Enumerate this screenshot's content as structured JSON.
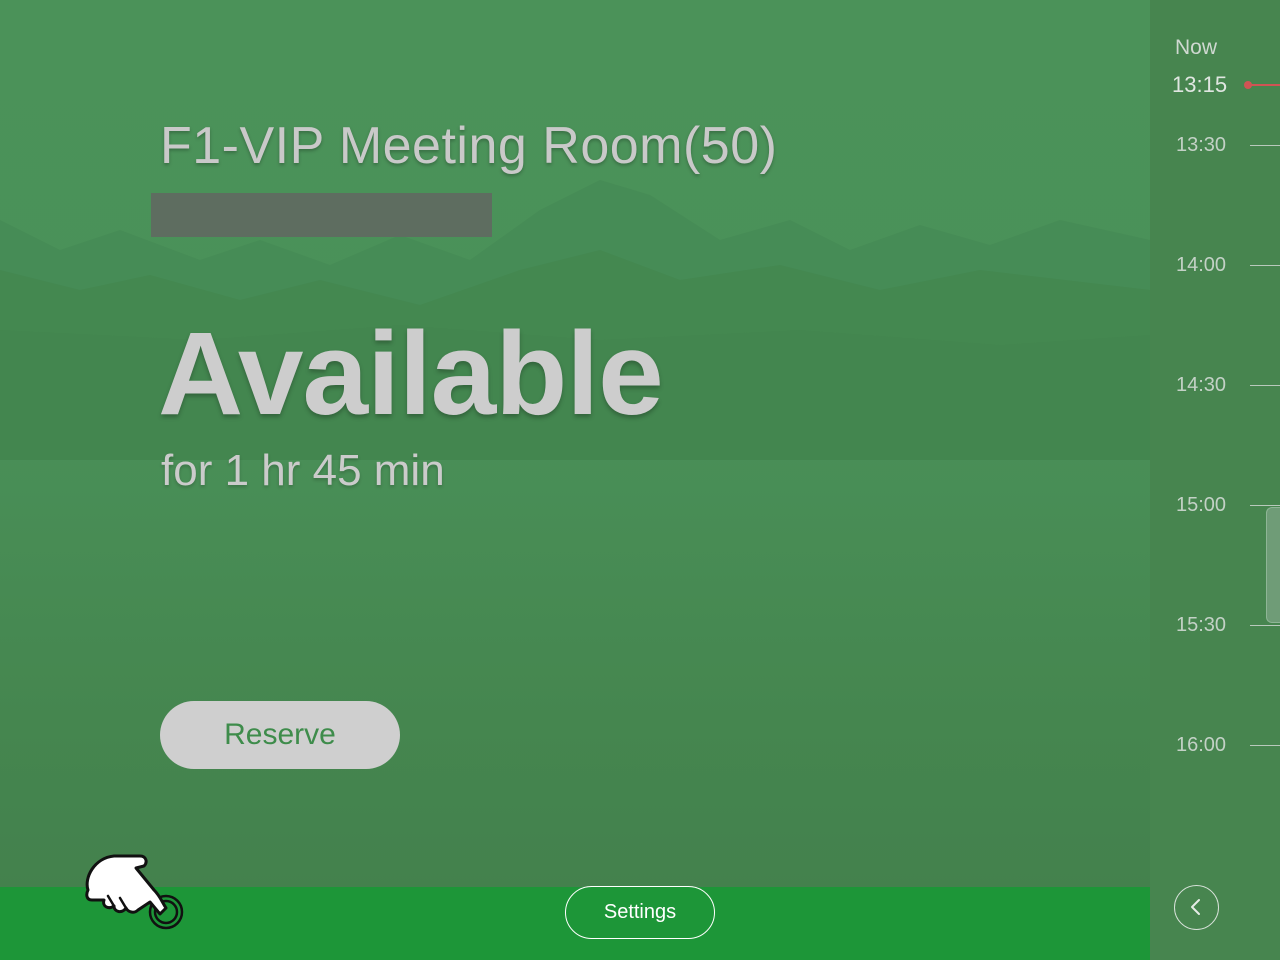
{
  "room": {
    "title": "F1-VIP Meeting Room(50)"
  },
  "status": {
    "label": "Available",
    "duration": "for 1 hr 45 min"
  },
  "actions": {
    "reserve_label": "Reserve",
    "settings_label": "Settings"
  },
  "timeline": {
    "now_label": "Now",
    "now_time": "13:15",
    "slots": [
      "13:30",
      "14:00",
      "14:30",
      "15:00",
      "15:30",
      "16:00"
    ]
  },
  "colors": {
    "background": "#4a9259",
    "bottom_bar": "#1d9638",
    "now_indicator": "#d05454",
    "reserve_text": "#3e8c4b"
  },
  "icons": {
    "hand": "hand-tap-icon",
    "collapse": "chevron-left-icon"
  }
}
